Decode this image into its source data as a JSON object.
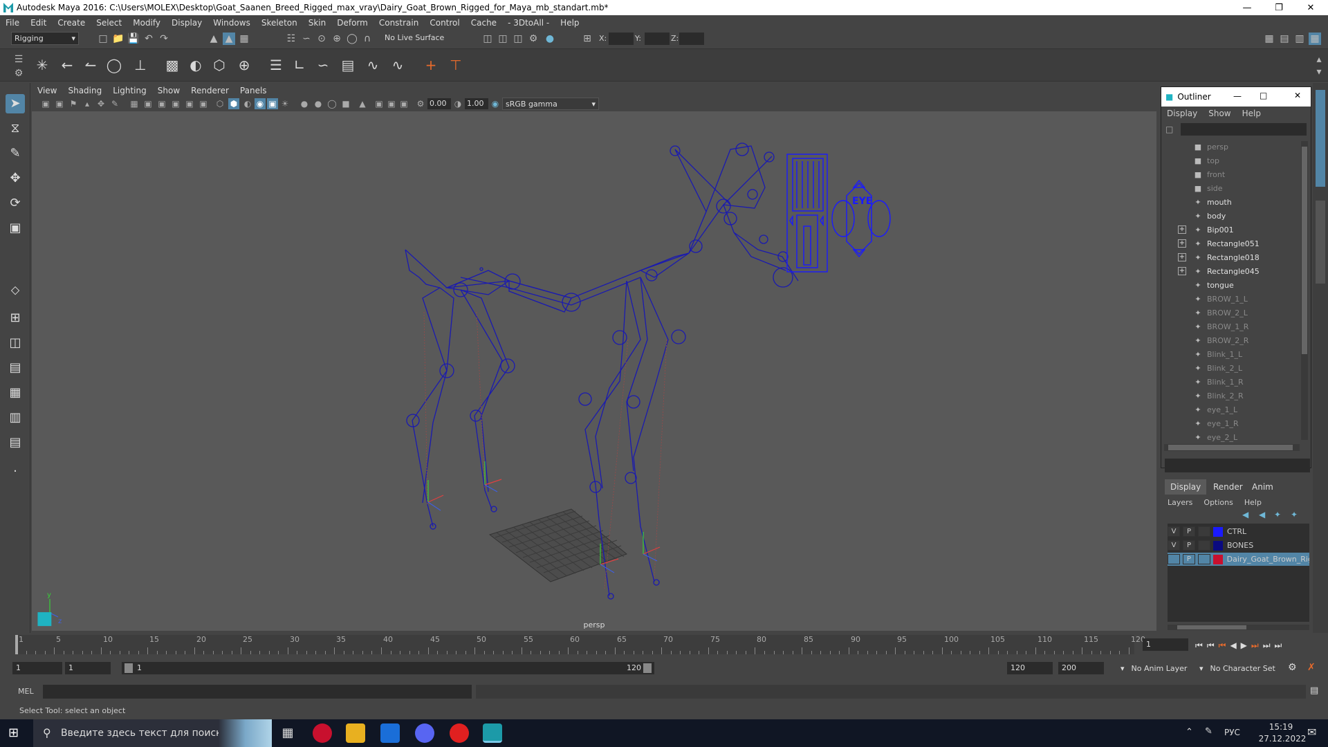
{
  "window": {
    "title": "Autodesk Maya 2016: C:\\Users\\MOLEX\\Desktop\\Goat_Saanen_Breed_Rigged_max_vray\\Dairy_Goat_Brown_Rigged_for_Maya_mb_standart.mb*"
  },
  "menubar": [
    "File",
    "Edit",
    "Create",
    "Select",
    "Modify",
    "Display",
    "Windows",
    "Skeleton",
    "Skin",
    "Deform",
    "Constrain",
    "Control",
    "Cache",
    "- 3DtoAll -",
    "Help"
  ],
  "statusline": {
    "mode": "Rigging",
    "live_surface": "No Live Surface",
    "x_label": "X:",
    "y_label": "Y:",
    "z_label": "Z:"
  },
  "viewport": {
    "menu": [
      "View",
      "Shading",
      "Lighting",
      "Show",
      "Renderer",
      "Panels"
    ],
    "exposure": "0.00",
    "gamma": "1.00",
    "color_space": "sRGB gamma",
    "camera_label": "persp",
    "eye_label": "EYE",
    "axis_y": "y",
    "axis_x": "x",
    "axis_z": "z"
  },
  "outliner": {
    "title": "Outliner",
    "menu": [
      "Display",
      "Show",
      "Help"
    ],
    "items": [
      {
        "label": "persp",
        "dim": true,
        "expand": false
      },
      {
        "label": "top",
        "dim": true,
        "expand": false
      },
      {
        "label": "front",
        "dim": true,
        "expand": false
      },
      {
        "label": "side",
        "dim": true,
        "expand": false
      },
      {
        "label": "mouth",
        "dim": false,
        "expand": false
      },
      {
        "label": "body",
        "dim": false,
        "expand": false
      },
      {
        "label": "Bip001",
        "dim": false,
        "expand": true
      },
      {
        "label": "Rectangle051",
        "dim": false,
        "expand": true
      },
      {
        "label": "Rectangle018",
        "dim": false,
        "expand": true
      },
      {
        "label": "Rectangle045",
        "dim": false,
        "expand": true
      },
      {
        "label": "tongue",
        "dim": false,
        "expand": false
      },
      {
        "label": "BROW_1_L",
        "dim": true,
        "expand": false
      },
      {
        "label": "BROW_2_L",
        "dim": true,
        "expand": false
      },
      {
        "label": "BROW_1_R",
        "dim": true,
        "expand": false
      },
      {
        "label": "BROW_2_R",
        "dim": true,
        "expand": false
      },
      {
        "label": "Blink_1_L",
        "dim": true,
        "expand": false
      },
      {
        "label": "Blink_2_L",
        "dim": true,
        "expand": false
      },
      {
        "label": "Blink_1_R",
        "dim": true,
        "expand": false
      },
      {
        "label": "Blink_2_R",
        "dim": true,
        "expand": false
      },
      {
        "label": "eye_1_L",
        "dim": true,
        "expand": false
      },
      {
        "label": "eye_1_R",
        "dim": true,
        "expand": false
      },
      {
        "label": "eye_2_L",
        "dim": true,
        "expand": false
      }
    ]
  },
  "layers": {
    "tabs": [
      "Display",
      "Render",
      "Anim"
    ],
    "menu": [
      "Layers",
      "Options",
      "Help"
    ],
    "rows": [
      {
        "v": "V",
        "p": "P",
        "color": "#1a1aff",
        "name": "CTRL"
      },
      {
        "v": "V",
        "p": "P",
        "color": "#0a0a80",
        "name": "BONES"
      },
      {
        "v": "",
        "p": "P",
        "color": "#c8102e",
        "name": "Dairy_Goat_Brown_Rig"
      }
    ]
  },
  "timeline": {
    "labels": [
      "1",
      "5",
      "10",
      "15",
      "20",
      "25",
      "30",
      "35",
      "40",
      "45",
      "50",
      "55",
      "60",
      "65",
      "70",
      "75",
      "80",
      "85",
      "90",
      "95",
      "100",
      "105",
      "110",
      "115",
      "120"
    ],
    "current_frame": "1"
  },
  "range": {
    "start": "1",
    "playback_start": "1",
    "slider_start": "1",
    "slider_end": "120",
    "playback_end": "120",
    "end": "200",
    "anim_layer": "No Anim Layer",
    "character_set": "No Character Set"
  },
  "cmdline": {
    "label": "MEL"
  },
  "helpline": "Select Tool: select an object",
  "taskbar": {
    "search_placeholder": "Введите здесь текст для поиска",
    "lang": "РУС",
    "time": "15:19",
    "date": "27.12.2022"
  }
}
